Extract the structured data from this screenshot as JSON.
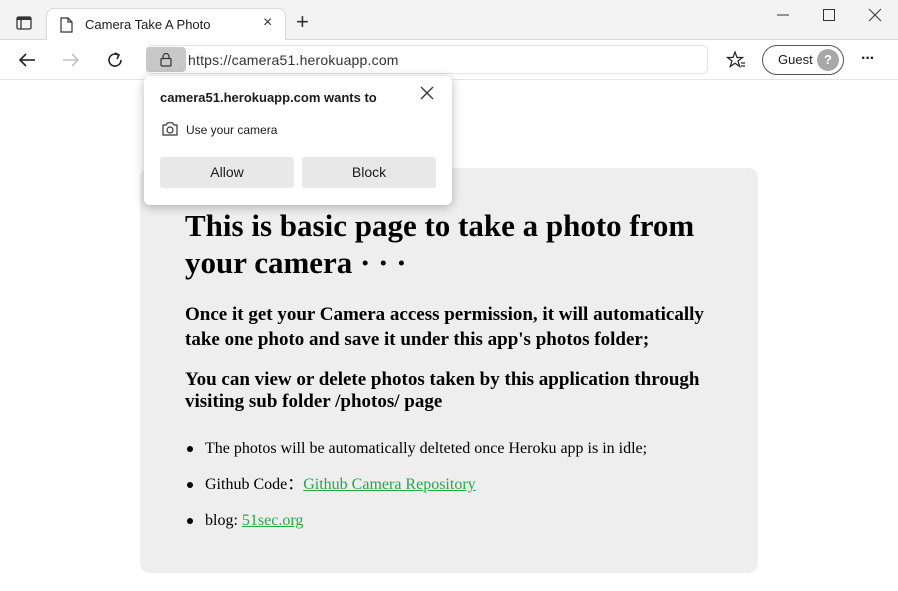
{
  "browser": {
    "tab_title": "Camera Take A Photo",
    "tab_close": "×",
    "new_tab": "+",
    "url": "https://camera51.herokuapp.com",
    "profile_label": "Guest",
    "avatar_glyph": "?",
    "more_glyph": "···"
  },
  "permission_popup": {
    "title": "camera51.herokuapp.com wants to",
    "permission": "Use your camera",
    "allow_label": "Allow",
    "block_label": "Block"
  },
  "page": {
    "heading": "This is basic page to take a photo from your camera · · ·",
    "para1": "Once it get your Camera access permission, it will automatically take one photo and save it under this app's photos folder;",
    "para2": "You can view or delete photos taken by this application through visiting sub folder /photos/ page",
    "list": [
      {
        "text": "The photos will be automatically delteted once Heroku app is in idle;"
      },
      {
        "prefix": "Github Code：",
        "link": "Github Camera Repository"
      },
      {
        "prefix": "blog: ",
        "link": "51sec.org"
      }
    ]
  },
  "colors": {
    "link": "#27a844",
    "card_bg": "#eeeeee",
    "button_bg": "#e8e8e8"
  }
}
